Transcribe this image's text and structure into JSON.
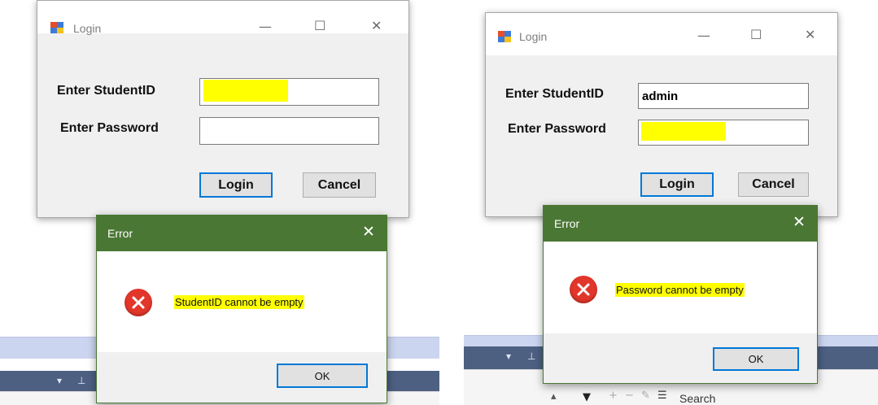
{
  "left": {
    "login": {
      "title": "Login",
      "studentid_label": "Enter StudentID",
      "studentid_value": "",
      "password_label": "Enter Password",
      "password_value": "",
      "login_button": "Login",
      "cancel_button": "Cancel"
    },
    "error": {
      "title": "Error",
      "message": "StudentID cannot be empty",
      "ok_button": "OK"
    }
  },
  "right": {
    "login": {
      "title": "Login",
      "studentid_label": "Enter StudentID",
      "studentid_value": "admin",
      "password_label": "Enter Password",
      "password_value": "",
      "login_button": "Login",
      "cancel_button": "Cancel"
    },
    "error": {
      "title": "Error",
      "message": "Password cannot be empty",
      "ok_button": "OK"
    },
    "ide_toolbar": {
      "search_label": "Search"
    }
  },
  "icons": {
    "window_controls": [
      "minimize-icon",
      "maximize-icon",
      "close-icon"
    ],
    "error_icon": "error-icon",
    "app_icon": "app-form-icon"
  },
  "colors": {
    "highlight": "#ffff00",
    "error_titlebar": "#4a7734",
    "default_button_border": "#0078d7",
    "error_icon": "#e2362a"
  }
}
